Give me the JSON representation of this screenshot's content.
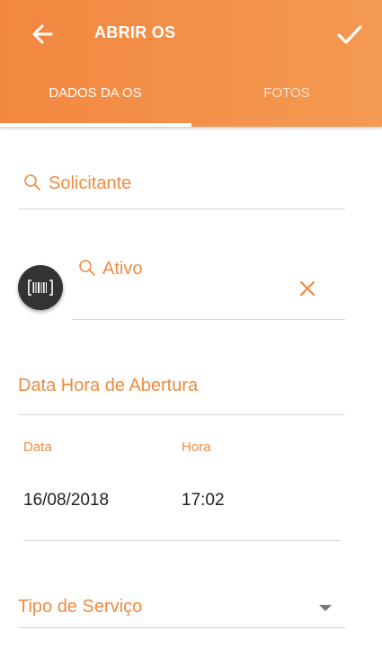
{
  "header": {
    "title": "ABRIR OS",
    "back_icon": "arrow-left-icon",
    "confirm_icon": "check-icon"
  },
  "tabs": [
    {
      "label": "DADOS DA OS",
      "active": true
    },
    {
      "label": "FOTOS",
      "active": false
    }
  ],
  "form": {
    "solicitante": {
      "placeholder": "Solicitante",
      "icon": "search-icon"
    },
    "ativo": {
      "placeholder": "Ativo",
      "icon": "search-icon",
      "clear_icon": "close-icon",
      "barcode_icon": "barcode-icon"
    },
    "data_hora": {
      "label": "Data Hora de Abertura",
      "date_label": "Data",
      "date_value": "16/08/2018",
      "time_label": "Hora",
      "time_value": "17:02"
    },
    "tipo_servico": {
      "placeholder": "Tipo de Serviço",
      "icon": "dropdown-arrow-icon"
    }
  },
  "colors": {
    "accent": "#f08a3f",
    "header_start": "#f3873f",
    "header_end": "#f49a52",
    "fab": "#333333"
  }
}
